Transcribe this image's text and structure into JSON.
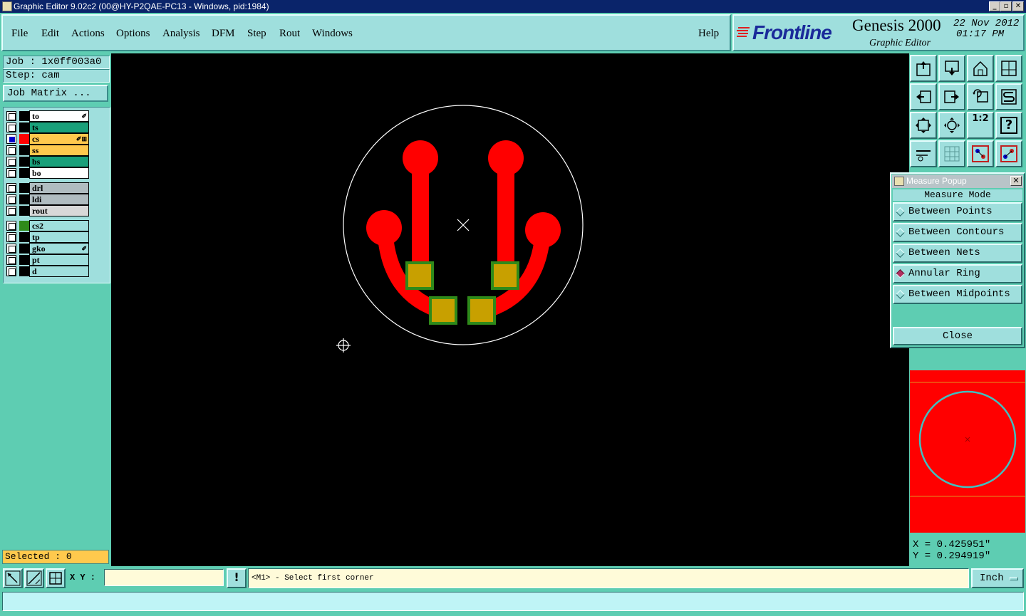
{
  "window": {
    "title": "Graphic Editor 9.02c2 (00@HY-P2QAE-PC13 - Windows, pid:1984)"
  },
  "menu": [
    {
      "label": "File"
    },
    {
      "label": "Edit"
    },
    {
      "label": "Actions"
    },
    {
      "label": "Options"
    },
    {
      "label": "Analysis"
    },
    {
      "label": "DFM"
    },
    {
      "label": "Step"
    },
    {
      "label": "Rout"
    },
    {
      "label": "Windows"
    }
  ],
  "help_label": "Help",
  "brand": {
    "logo": "Frontline",
    "product": "Genesis 2000",
    "subtitle": "Graphic Editor",
    "date": "22 Nov 2012",
    "time": "01:17 PM"
  },
  "job": {
    "job_text": "Job : 1x0ff003a0",
    "step_text": "Step: cam",
    "matrix_label": "Job Matrix ..."
  },
  "layers": [
    {
      "name": "to",
      "bg": "#ffffff",
      "swatch": "#000000",
      "mark": "✐",
      "checked": false
    },
    {
      "name": "ts",
      "bg": "#19a07a",
      "swatch": "#000000",
      "mark": "",
      "checked": false
    },
    {
      "name": "cs",
      "bg": "#ffc94d",
      "swatch": "#ff0000",
      "mark": "✐⊞",
      "checked": true
    },
    {
      "name": "ss",
      "bg": "#ffc94d",
      "swatch": "#000000",
      "mark": "",
      "checked": false
    },
    {
      "name": "bs",
      "bg": "#19a07a",
      "swatch": "#000000",
      "mark": "",
      "checked": false
    },
    {
      "name": "bo",
      "bg": "#ffffff",
      "swatch": "#000000",
      "mark": "",
      "checked": false
    },
    {
      "name": "drl",
      "bg": "#b0bcc0",
      "swatch": "#000000",
      "mark": "",
      "checked": false
    },
    {
      "name": "ldi",
      "bg": "#b0bcc0",
      "swatch": "#000000",
      "mark": "",
      "checked": false
    },
    {
      "name": "rout",
      "bg": "#d8d8d8",
      "swatch": "#000000",
      "mark": "",
      "checked": false
    },
    {
      "name": "cs2",
      "bg": "#9fdfdd",
      "swatch": "#2f8a1a",
      "mark": "",
      "checked": false
    },
    {
      "name": "tp",
      "bg": "#9fdfdd",
      "swatch": "#000000",
      "mark": "",
      "checked": false
    },
    {
      "name": "gko",
      "bg": "#9fdfdd",
      "swatch": "#000000",
      "mark": "✐",
      "checked": false
    },
    {
      "name": "pt",
      "bg": "#9fdfdd",
      "swatch": "#000000",
      "mark": "",
      "checked": false
    },
    {
      "name": "d",
      "bg": "#9fdfdd",
      "swatch": "#000000",
      "mark": "",
      "checked": false
    }
  ],
  "selected_text": "Selected : 0",
  "measure": {
    "window_title": "Measure Popup",
    "mode_title": "Measure Mode",
    "options": [
      {
        "label": "Between Points",
        "selected": false
      },
      {
        "label": "Between Contours",
        "selected": false
      },
      {
        "label": "Between Nets",
        "selected": false
      },
      {
        "label": "Annular Ring",
        "selected": true
      },
      {
        "label": "Between Midpoints",
        "selected": false
      }
    ],
    "close_label": "Close"
  },
  "tools": [
    {
      "icon": "zoom-home-up-icon"
    },
    {
      "icon": "zoom-down-icon"
    },
    {
      "icon": "home-icon"
    },
    {
      "icon": "window-split-icon"
    },
    {
      "icon": "pan-left-icon"
    },
    {
      "icon": "pan-right-icon"
    },
    {
      "icon": "redraw-icon"
    },
    {
      "icon": "s-curve-icon"
    },
    {
      "icon": "fit-all-icon"
    },
    {
      "icon": "zoom-center-icon"
    },
    {
      "icon": "scale-one-to-two-icon"
    },
    {
      "icon": "help-question-icon"
    },
    {
      "icon": "ruler-tools-icon"
    },
    {
      "icon": "grid-icon"
    },
    {
      "icon": "net-layers-icon"
    },
    {
      "icon": "net-layers-alt-icon"
    }
  ],
  "tool_labels": {
    "scale": "1:2",
    "help": "?"
  },
  "coords": {
    "x_text": "X = 0.425951\"",
    "y_text": "Y = 0.294919\""
  },
  "xy_label": "X Y :",
  "xy_input": {
    "value": ""
  },
  "exclaim": "!",
  "message": "<M1> - Select first corner",
  "unit": {
    "value": "Inch"
  },
  "colors": {
    "copper": "#ff0000",
    "pad": "#c8a000",
    "pad_border": "#2f8a1a",
    "outline": "#ffffff",
    "preview_ring": "#40c0c0"
  }
}
